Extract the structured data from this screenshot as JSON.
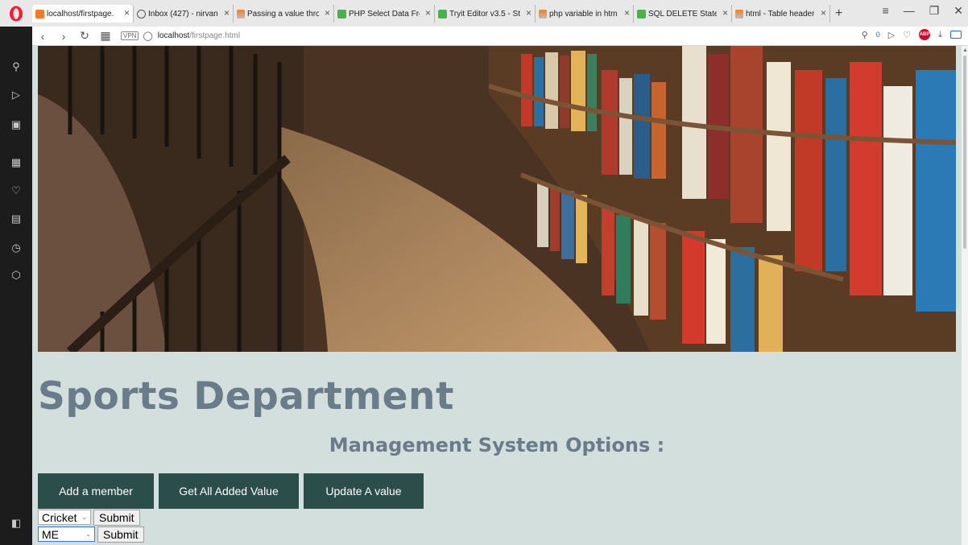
{
  "browser": {
    "tabs": [
      {
        "label": "localhost/firstpage.",
        "favicon": "orange-page-icon",
        "active": true
      },
      {
        "label": "Inbox (427) - nirvan",
        "favicon": "loading-icon",
        "active": false
      },
      {
        "label": "Passing a value thro",
        "favicon": "stackoverflow-icon",
        "active": false
      },
      {
        "label": "PHP Select Data Fro",
        "favicon": "w3schools-icon",
        "active": false
      },
      {
        "label": "Tryit Editor v3.5 - St",
        "favicon": "w3schools-icon",
        "active": false
      },
      {
        "label": "php variable in htm",
        "favicon": "stackoverflow-icon",
        "active": false
      },
      {
        "label": "SQL DELETE Statem",
        "favicon": "w3schools-icon",
        "active": false
      },
      {
        "label": "html - Table header",
        "favicon": "stackoverflow-icon",
        "active": false
      }
    ],
    "tab_close_glyph": "×",
    "new_tab_glyph": "+",
    "url_host": "localhost",
    "url_path": "/firstpage.html",
    "vpn_label": "VPN",
    "badge_count": "0",
    "abp_label": "ABP"
  },
  "page": {
    "title": "Sports Department",
    "subtitle": "Management System Options :",
    "menu": [
      {
        "label": "Add a member"
      },
      {
        "label": "Get All Added Value"
      },
      {
        "label": "Update A value"
      }
    ],
    "forms": [
      {
        "select_value": "Cricket",
        "submit_label": "Submit"
      },
      {
        "select_value": "ME",
        "submit_label": "Submit"
      }
    ]
  },
  "colors": {
    "page_bg": "#d3dfdd",
    "heading": "#6a7b89",
    "menu_button_bg": "#2c4e4b",
    "opera_red": "#ff1b2d"
  }
}
